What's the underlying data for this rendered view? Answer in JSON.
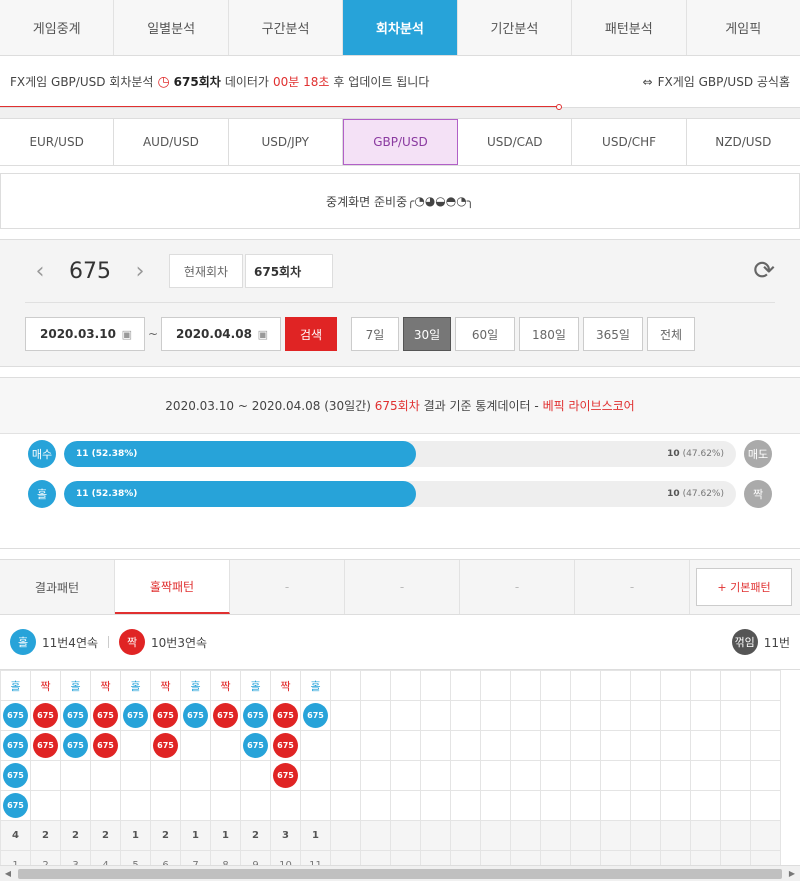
{
  "top_tabs": [
    "게임중계",
    "일별분석",
    "구간분석",
    "회차분석",
    "기간분석",
    "패턴분석",
    "게임픽"
  ],
  "info_bar": {
    "prefix": "FX게임 GBP/USD 회차분석",
    "round": "675회차",
    "mid": "데이터가",
    "time": "00분 18초",
    "suffix": "후 업데이트 됩니다",
    "link": "FX게임 GBP/USD 공식홈"
  },
  "pairs": [
    "EUR/USD",
    "AUD/USD",
    "USD/JPY",
    "GBP/USD",
    "USD/CAD",
    "USD/CHF",
    "NZD/USD"
  ],
  "broadcast": {
    "text": "중계화면 준비중 ",
    "emoticon": "╭◔◕◒◓◔╮"
  },
  "round_nav": {
    "number": "675",
    "current_button": "현재회차",
    "current_value": "675회차"
  },
  "date_filter": {
    "start": "2020.03.10",
    "end": "2020.04.08",
    "tilde": "~",
    "search": "검색",
    "periods": [
      "7일",
      "30일",
      "60일",
      "180일",
      "365일",
      "전체"
    ]
  },
  "stats": {
    "head_prefix": "2020.03.10 ~ 2020.04.08 (30일간)",
    "head_round": "675회차",
    "head_mid": "결과 기준 통계데이터 -",
    "head_source": "베픽 라이브스코어",
    "rows": [
      {
        "left_label": "매수",
        "left_value": "11 (52.38%)",
        "right_count": "10",
        "right_pct": "(47.62%)",
        "right_label": "매도",
        "fill_pct": 52.38
      },
      {
        "left_label": "홀",
        "left_value": "11 (52.38%)",
        "right_count": "10",
        "right_pct": "(47.62%)",
        "right_label": "짝",
        "fill_pct": 52.38
      }
    ]
  },
  "pattern_tabs": {
    "tabs": [
      "결과패턴",
      "홀짝패턴",
      "-",
      "-",
      "-",
      "-"
    ],
    "basic": "+ 기본패턴"
  },
  "summary": {
    "odd_label": "홀",
    "odd_text": "11번4연속",
    "even_label": "짝",
    "even_text": "10번3연속",
    "turn_label": "꺾임",
    "turn_text": "11번"
  },
  "grid": {
    "headers": [
      "홀",
      "짝",
      "홀",
      "짝",
      "홀",
      "짝",
      "홀",
      "짝",
      "홀",
      "짝",
      "홀"
    ],
    "heights": [
      4,
      2,
      2,
      2,
      1,
      2,
      1,
      1,
      2,
      3,
      1
    ],
    "counts": [
      "4",
      "2",
      "2",
      "2",
      "1",
      "2",
      "1",
      "1",
      "2",
      "3",
      "1"
    ],
    "ball_label": "675",
    "total_columns": 26
  }
}
